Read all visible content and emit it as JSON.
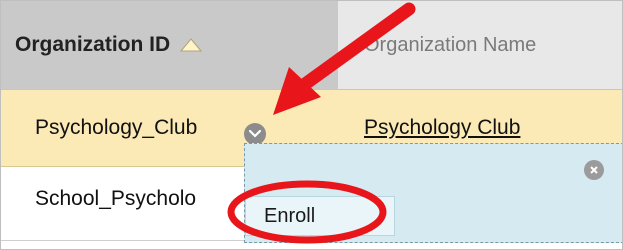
{
  "table": {
    "columns": [
      {
        "label": "Organization ID",
        "sort": "ascending"
      },
      {
        "label": "Organization Name"
      }
    ],
    "rows": [
      {
        "id": "Psychology_Club",
        "name": "Psychology Club"
      },
      {
        "id": "School_Psycholo"
      }
    ]
  },
  "context_menu": {
    "items": [
      {
        "label": "Enroll"
      }
    ]
  },
  "colors": {
    "header_sorted": "#c9c9c9",
    "header": "#e8e8e8",
    "row_selected": "#fbeab6",
    "menu_bg": "#d6eaf1",
    "annotation_red": "#e8161b"
  },
  "icons": {
    "sort": "triangle-up-icon",
    "row_menu": "chevron-down-icon",
    "close": "close-icon"
  }
}
